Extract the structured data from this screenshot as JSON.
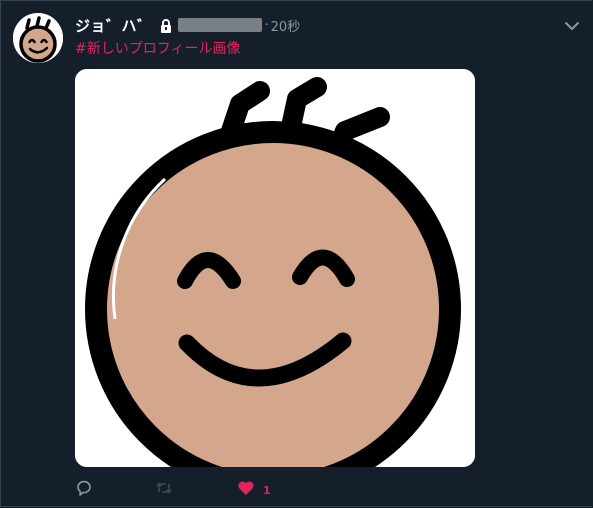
{
  "tweet": {
    "display_name": "ジョ゛ハ゛",
    "time_separator": "·",
    "timestamp": "20秒",
    "text": "#新しいプロフィール画像",
    "like_count": "1"
  },
  "colors": {
    "background": "#151f2b",
    "hashtag": "#e0245e",
    "muted": "#8899a6",
    "face": "#d4a68c",
    "outline": "#000000",
    "like": "#e0245e"
  },
  "icons": {
    "lock": "lock-icon",
    "chevron": "chevron-down-icon",
    "reply": "reply-icon",
    "retweet": "retweet-icon",
    "like": "heart-icon"
  }
}
